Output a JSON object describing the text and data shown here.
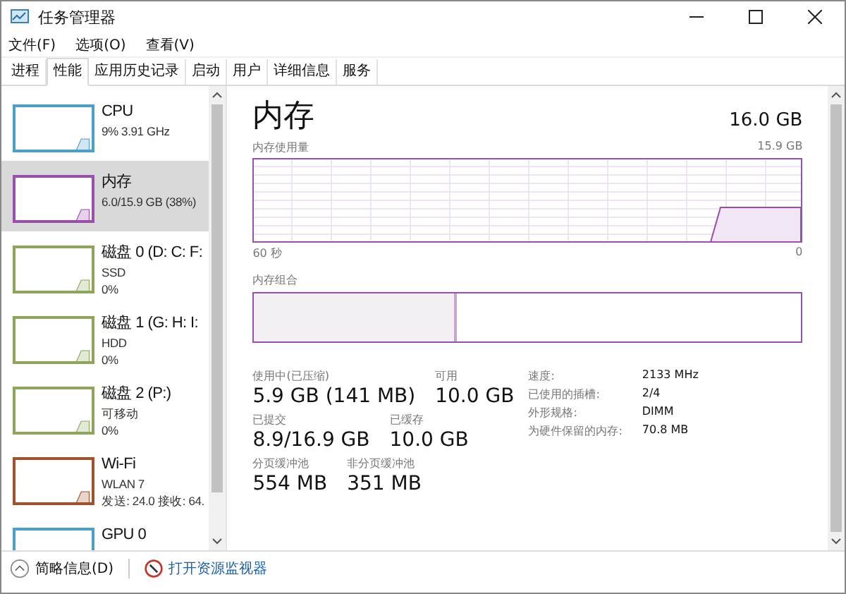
{
  "window": {
    "title": "任务管理器"
  },
  "menu": [
    "文件(F)",
    "选项(O)",
    "查看(V)"
  ],
  "tabs": [
    {
      "label": "进程",
      "selected": false
    },
    {
      "label": "性能",
      "selected": true
    },
    {
      "label": "应用历史记录",
      "selected": false
    },
    {
      "label": "启动",
      "selected": false
    },
    {
      "label": "用户",
      "selected": false
    },
    {
      "label": "详细信息",
      "selected": false
    },
    {
      "label": "服务",
      "selected": false
    }
  ],
  "sidebar": {
    "items": [
      {
        "title": "CPU",
        "lines": [
          "9% 3.91 GHz"
        ],
        "color": "#4aa0c8",
        "selected": false
      },
      {
        "title": "内存",
        "lines": [
          "6.0/15.9 GB (38%)"
        ],
        "color": "#9b4fad",
        "selected": true
      },
      {
        "title": "磁盘 0 (D: C: F:",
        "lines": [
          "SSD",
          "0%"
        ],
        "color": "#8da65a",
        "selected": false
      },
      {
        "title": "磁盘 1 (G: H: I:",
        "lines": [
          "HDD",
          "0%"
        ],
        "color": "#8da65a",
        "selected": false
      },
      {
        "title": "磁盘 2 (P:)",
        "lines": [
          "可移动",
          "0%"
        ],
        "color": "#8da65a",
        "selected": false
      },
      {
        "title": "Wi-Fi",
        "lines": [
          "WLAN 7",
          "发送: 24.0 接收: 64."
        ],
        "color": "#a0522d",
        "selected": false
      },
      {
        "title": "GPU 0",
        "color": "#4aa0c8",
        "selected": false
      }
    ]
  },
  "detail": {
    "title": "内存",
    "total": "16.0 GB",
    "usage_label": "内存使用量",
    "usage_max": "15.9 GB",
    "time_start": "60 秒",
    "time_end": "0",
    "composition_label": "内存组合",
    "composition": {
      "level": 0.37
    },
    "stats": [
      [
        {
          "label": "使用中(已压缩)",
          "value": "5.9 GB (141 MB)"
        },
        {
          "label": "可用",
          "value": "10.0 GB"
        }
      ],
      [
        {
          "label": "已提交",
          "value": "8.9/16.9 GB"
        },
        {
          "label": "已缓存",
          "value": "10.0 GB"
        }
      ],
      [
        {
          "label": "分页缓冲池",
          "value": "554 MB"
        },
        {
          "label": "非分页缓冲池",
          "value": "351 MB"
        }
      ]
    ],
    "specs": [
      {
        "label": "速度:",
        "value": "2133 MHz"
      },
      {
        "label": "已使用的插槽:",
        "value": "2/4"
      },
      {
        "label": "外形规格:",
        "value": "DIMM"
      },
      {
        "label": "为硬件保留的内存:",
        "value": "70.8 MB"
      }
    ]
  },
  "footer": {
    "details": "简略信息(D)",
    "monitor": "打开资源监视器"
  }
}
